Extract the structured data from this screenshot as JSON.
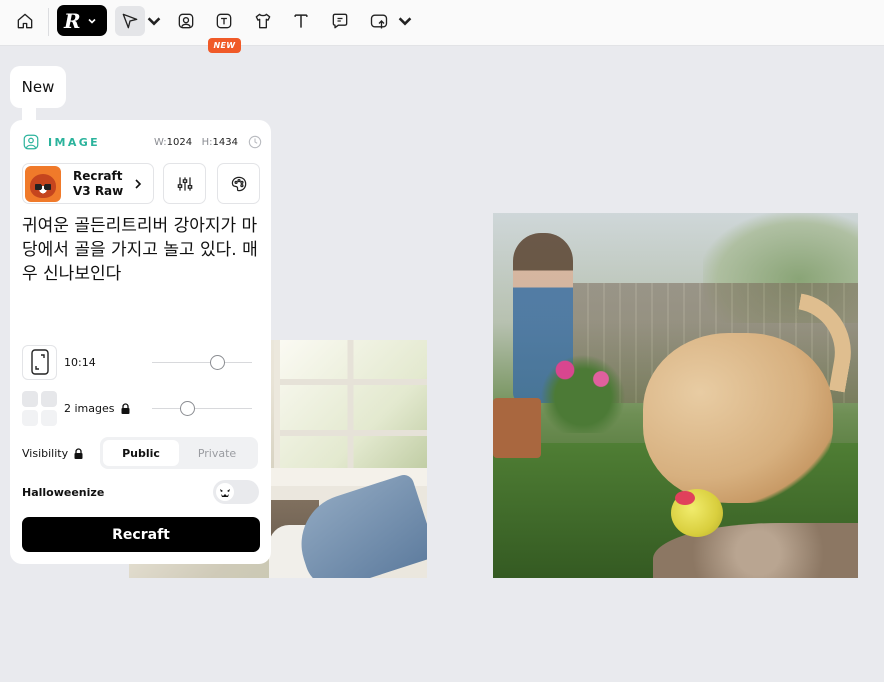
{
  "toolbar": {
    "tools": [
      {
        "name": "home-icon"
      },
      {
        "name": "recraft-logo",
        "glyph": "R"
      },
      {
        "name": "pointer-icon"
      },
      {
        "name": "image-frame-icon"
      },
      {
        "name": "text-frame-icon"
      },
      {
        "name": "mockup-shirt-icon"
      },
      {
        "name": "text-icon"
      },
      {
        "name": "comment-icon"
      },
      {
        "name": "export-icon"
      }
    ],
    "new_badge": "NEW",
    "badge_color": "#f05a28"
  },
  "tag": {
    "label": "New"
  },
  "panel": {
    "type_label": "IMAGE",
    "accent_color": "#2bb39c",
    "width_key": "W:",
    "width_value": "1024",
    "height_key": "H:",
    "height_value": "1434",
    "model": {
      "name": "Recraft V3 Raw"
    },
    "prompt": "귀여운 골든리트리버 강아지가 마당에서 골을 가지고 놀고 있다. 매우 신나보인다",
    "ratio": {
      "label": "10:14",
      "slider_fraction": 0.65
    },
    "count": {
      "label": "2 images",
      "slider_fraction": 0.35,
      "locked": true
    },
    "visibility": {
      "label": "Visibility",
      "options": [
        "Public",
        "Private"
      ],
      "selected": "Public"
    },
    "halloweenize": {
      "label": "Halloweenize",
      "enabled": false
    },
    "submit_label": "Recraft"
  }
}
